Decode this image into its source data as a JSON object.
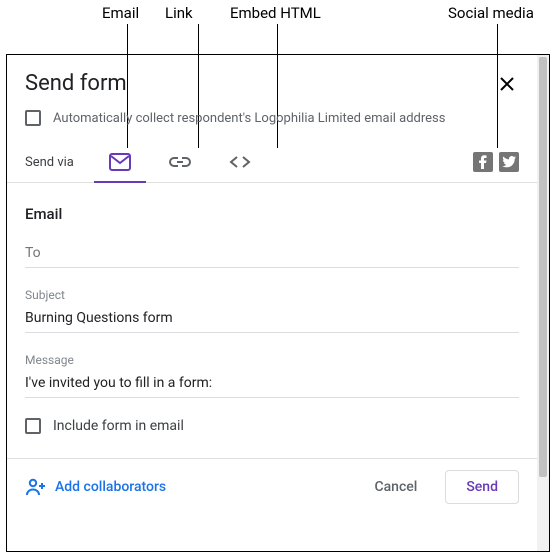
{
  "annotations": {
    "email": "Email",
    "link": "Link",
    "embed": "Embed HTML",
    "social": "Social media"
  },
  "dialog": {
    "title": "Send form",
    "auto_collect": "Automatically collect respondent's Logophilia Limited email address",
    "send_via_label": "Send via"
  },
  "tabs": {
    "email": "email-icon",
    "link": "link-icon",
    "embed": "embed-icon"
  },
  "socials": {
    "facebook": "facebook-icon",
    "twitter": "twitter-icon"
  },
  "email": {
    "title": "Email",
    "to_label": "To",
    "to_value": "",
    "subject_label": "Subject",
    "subject_value": "Burning Questions form",
    "message_label": "Message",
    "message_value": "I've invited you to fill in a form:",
    "include_label": "Include form in email"
  },
  "footer": {
    "add_collaborators": "Add collaborators",
    "cancel": "Cancel",
    "send": "Send"
  },
  "colors": {
    "accent": "#673ab7",
    "link": "#1a73e8"
  }
}
